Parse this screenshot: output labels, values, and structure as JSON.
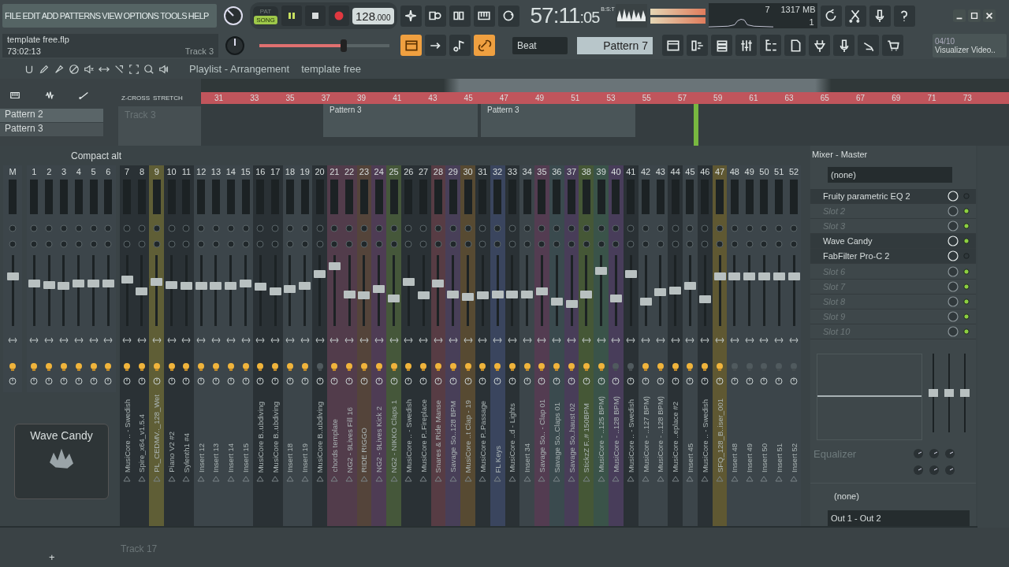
{
  "menu": [
    "FILE",
    "EDIT",
    "ADD",
    "PATTERNS",
    "VIEW",
    "OPTIONS",
    "TOOLS",
    "HELP"
  ],
  "hint": {
    "file": "template free.flp",
    "time": "73:02:13",
    "track": "Track 3"
  },
  "modes": [
    {
      "label": "PAT",
      "selected": false
    },
    {
      "label": "SONG",
      "selected": true
    }
  ],
  "tempo": {
    "whole": "128",
    "fraction": ".000"
  },
  "clock": {
    "time": "57:11",
    "ticks": ":05",
    "unit": "B:S:T"
  },
  "cpu": {
    "cores": "7",
    "memory": "1317 MB",
    "voices": "1"
  },
  "master_volume": {
    "level": 0.67
  },
  "snap": "Beat",
  "pattern": "Pattern 7",
  "news": {
    "count": "04/10",
    "title": "Visualizer Video.."
  },
  "playlist": {
    "title": "Playlist - Arrangement",
    "project": "template free",
    "z_cross": "Z-CROSS",
    "stretch": "STRETCH",
    "picker": [
      {
        "label": "Pattern 2",
        "selected": true
      },
      {
        "label": "Pattern 3",
        "selected": false
      }
    ],
    "track": "Track 3",
    "ruler": [
      "31",
      "33",
      "35",
      "37",
      "39",
      "41",
      "43",
      "45",
      "47",
      "49",
      "51",
      "53",
      "55",
      "57",
      "59",
      "61",
      "63",
      "65",
      "67",
      "69",
      "71",
      "73"
    ],
    "clips": [
      {
        "label": "Pattern 3"
      },
      {
        "label": "Pattern 3"
      }
    ],
    "bottom_track": "Track 17",
    "add": "+"
  },
  "mixer": {
    "preset": "Compact alt",
    "overlay_title": "Wave Candy",
    "channels": [
      {
        "number": "M",
        "color": "#3c454a",
        "level": 0.72,
        "on": true
      },
      {
        "number": "1",
        "color": "#3c454a",
        "level": 0.61,
        "on": true
      },
      {
        "number": "2",
        "color": "#3c454a",
        "level": 0.59,
        "on": true
      },
      {
        "number": "3",
        "color": "#3c454a",
        "level": 0.57,
        "on": true
      },
      {
        "number": "4",
        "color": "#3c454a",
        "level": 0.61,
        "on": true
      },
      {
        "number": "5",
        "color": "#3c454a",
        "level": 0.61,
        "on": true
      },
      {
        "number": "6",
        "color": "#3c454a",
        "level": 0.61,
        "on": true
      },
      {
        "number": "7",
        "label": "MusiCore .. - Swedish",
        "color": "#2a3135",
        "level": 0.67,
        "on": true
      },
      {
        "number": "8",
        "label": "Spire_x64_v1.5.4",
        "color": "#2a3135",
        "level": 0.49,
        "on": true
      },
      {
        "number": "9",
        "label": "PL_CEDMV.._128_Wet",
        "color": "#5f5e36",
        "level": 0.64,
        "on": true
      },
      {
        "number": "10",
        "label": "Piano V2 #2",
        "color": "#2a3135",
        "level": 0.59,
        "on": true
      },
      {
        "number": "11",
        "label": "Sylenth1 #4",
        "color": "#2a3135",
        "level": 0.57,
        "on": true
      },
      {
        "number": "12",
        "label": "Insert 12",
        "color": "#3c454a",
        "level": 0.57,
        "on": true
      },
      {
        "number": "13",
        "label": "Insert 13",
        "color": "#3c454a",
        "level": 0.57,
        "on": true
      },
      {
        "number": "14",
        "label": "Insert 14",
        "color": "#3c454a",
        "level": 0.57,
        "on": true
      },
      {
        "number": "15",
        "label": "Insert 15",
        "color": "#3c454a",
        "level": 0.61,
        "on": true
      },
      {
        "number": "16",
        "label": "MusiCore B..ubdiving",
        "color": "#2a3135",
        "level": 0.56,
        "on": true
      },
      {
        "number": "17",
        "label": "MusiCore B..ubdiving",
        "color": "#2a3135",
        "level": 0.49,
        "on": true
      },
      {
        "number": "18",
        "label": "Insert 18",
        "color": "#3c454a",
        "level": 0.53,
        "on": true
      },
      {
        "number": "19",
        "label": "Insert 19",
        "color": "#3c454a",
        "level": 0.58,
        "on": true
      },
      {
        "number": "20",
        "label": "MusiCore B..ubdiving",
        "color": "#2a3135",
        "level": 0.76,
        "on": false
      },
      {
        "number": "21",
        "label": "chords template",
        "color": "#523c4b",
        "level": 0.89,
        "on": true
      },
      {
        "number": "22",
        "label": "NG2 - 9Lives Fill 16",
        "color": "#523c4b",
        "level": 0.44,
        "on": true
      },
      {
        "number": "23",
        "label": "RIDE RIGGO",
        "color": "#54443a",
        "level": 0.42,
        "on": true
      },
      {
        "number": "24",
        "label": "NG2 - 9Lives Kick 2",
        "color": "#4e3c54",
        "level": 0.53,
        "on": true
      },
      {
        "number": "25",
        "label": "NG2 - NIKKO Claps 1",
        "color": "#45573a",
        "level": 0.38,
        "on": true
      },
      {
        "number": "26",
        "label": "MusiCore .. - Swedish",
        "color": "#2a3135",
        "level": 0.64,
        "on": true
      },
      {
        "number": "27",
        "label": "MusiCore P..Fireplace",
        "color": "#2a3135",
        "level": 0.42,
        "on": true
      },
      {
        "number": "28",
        "label": "Snares & Ride Manse",
        "color": "#573c44",
        "level": 0.61,
        "on": true
      },
      {
        "number": "29",
        "label": "Savage So..128 BPM",
        "color": "#483f58",
        "level": 0.44,
        "on": true
      },
      {
        "number": "30",
        "label": "MusiCore ..t Clap - 19",
        "color": "#574a32",
        "level": 0.4,
        "on": true
      },
      {
        "number": "31",
        "label": "MusiCore P..Passage",
        "color": "#2a3135",
        "level": 0.42,
        "on": true
      },
      {
        "number": "32",
        "label": "FL Keys",
        "color": "#3a455e",
        "level": 0.44,
        "on": true
      },
      {
        "number": "33",
        "label": "MusiCore ..d - Lights",
        "color": "#2a3135",
        "level": 0.44,
        "on": true
      },
      {
        "number": "34",
        "label": "Insert 34",
        "color": "#3c454a",
        "level": 0.44,
        "on": true
      },
      {
        "number": "35",
        "label": "Savage So.. - Clap 01",
        "color": "#533c51",
        "level": 0.49,
        "on": true
      },
      {
        "number": "36",
        "label": "Savage So..Claps 01",
        "color": "#3a4a4e",
        "level": 0.33,
        "on": true
      },
      {
        "number": "37",
        "label": "Savage So..haust 02",
        "color": "#483d58",
        "level": 0.29,
        "on": true
      },
      {
        "number": "38",
        "label": "StickzZ F..# 150BPM",
        "color": "#455736",
        "level": 0.44,
        "on": true
      },
      {
        "number": "39",
        "label": "MusiCore - ..125 BPM)",
        "color": "#3a5349",
        "level": 0.81,
        "on": true
      },
      {
        "number": "40",
        "label": "MusiCore - ..128 BPM)",
        "color": "#483d5a",
        "level": 0.38,
        "on": false
      },
      {
        "number": "41",
        "label": "MusiCore .. - Swedish",
        "color": "#2a3135",
        "level": 0.76,
        "on": false
      },
      {
        "number": "42",
        "label": "MusiCore - ..127 BPM)",
        "color": "#3c454a",
        "level": 0.33,
        "on": true
      },
      {
        "number": "43",
        "label": "MusiCore - ..128 BPM)",
        "color": "#3c454a",
        "level": 0.47,
        "on": true
      },
      {
        "number": "44",
        "label": "MusiCore ..eplace #2",
        "color": "#2a3135",
        "level": 0.5,
        "on": true
      },
      {
        "number": "45",
        "label": "Insert 45",
        "color": "#3c454a",
        "level": 0.58,
        "on": true
      },
      {
        "number": "46",
        "label": "MusiCore .. - Swedish",
        "color": "#2a3135",
        "level": 0.36,
        "on": true
      },
      {
        "number": "47",
        "label": "SFQ_128_B..iser_001",
        "color": "#5f5832",
        "level": 0.72,
        "on": true
      },
      {
        "number": "48",
        "label": "Insert 48",
        "color": "#3c454a",
        "level": 0.72,
        "on": false
      },
      {
        "number": "49",
        "label": "Insert 49",
        "color": "#3c454a",
        "level": 0.72,
        "on": false
      },
      {
        "number": "50",
        "label": "Insert 50",
        "color": "#3c454a",
        "level": 0.72,
        "on": false
      },
      {
        "number": "51",
        "label": "Insert 51",
        "color": "#3c454a",
        "level": 0.72,
        "on": false
      },
      {
        "number": "52",
        "label": "Insert 52",
        "color": "#3c454a",
        "level": 0.72,
        "on": false
      }
    ]
  },
  "master": {
    "title": "Mixer - Master",
    "input": "(none)",
    "slots": [
      {
        "name": "Fruity parametric EQ 2",
        "empty": false,
        "on": false
      },
      {
        "name": "Slot 2",
        "empty": true,
        "on": true
      },
      {
        "name": "Slot 3",
        "empty": true,
        "on": true
      },
      {
        "name": "Wave Candy",
        "empty": false,
        "on": true
      },
      {
        "name": "FabFilter Pro-C 2",
        "empty": false,
        "on": false
      },
      {
        "name": "Slot 6",
        "empty": true,
        "on": true
      },
      {
        "name": "Slot 7",
        "empty": true,
        "on": true
      },
      {
        "name": "Slot 8",
        "empty": true,
        "on": true
      },
      {
        "name": "Slot 9",
        "empty": true,
        "on": true
      },
      {
        "name": "Slot 10",
        "empty": true,
        "on": true
      }
    ],
    "eq_bands": [
      {
        "level": 0.5
      },
      {
        "level": 0.5
      },
      {
        "level": 0.5
      }
    ],
    "eq_label": "Equalizer",
    "sidechain": "(none)",
    "output": "Out 1 - Out 2"
  }
}
